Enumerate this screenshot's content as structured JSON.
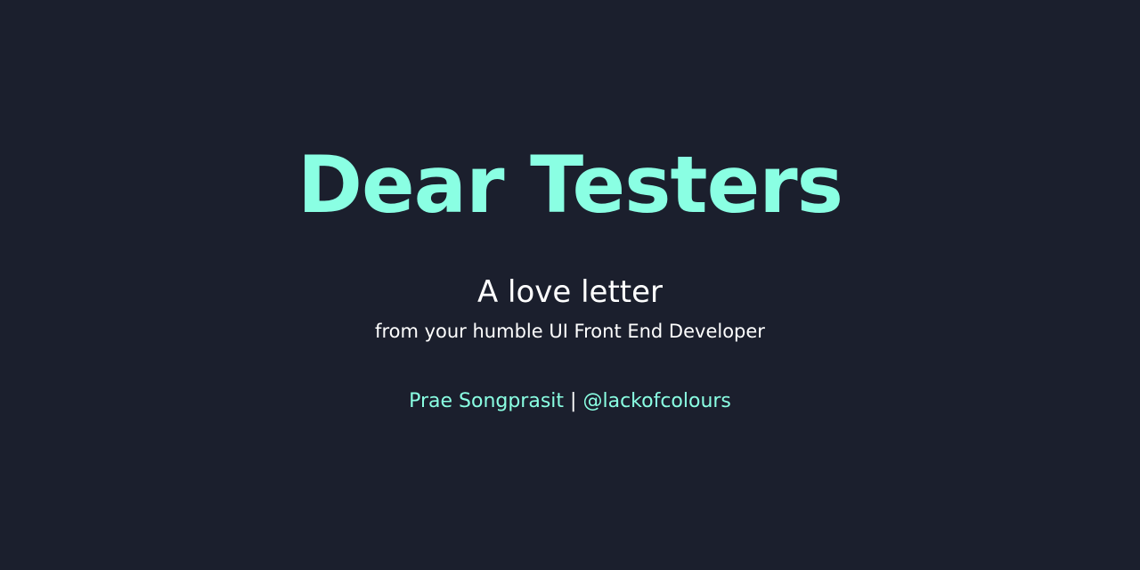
{
  "slide": {
    "title": "Dear Testers",
    "subtitle": "A love letter",
    "byline": "from your humble UI Front End Developer",
    "author": "Prae Songprasit",
    "separator": "|",
    "handle": "@lackofcolours"
  },
  "colors": {
    "background": "#1b1f2d",
    "accent": "#8affe3",
    "text": "#ffffff"
  }
}
